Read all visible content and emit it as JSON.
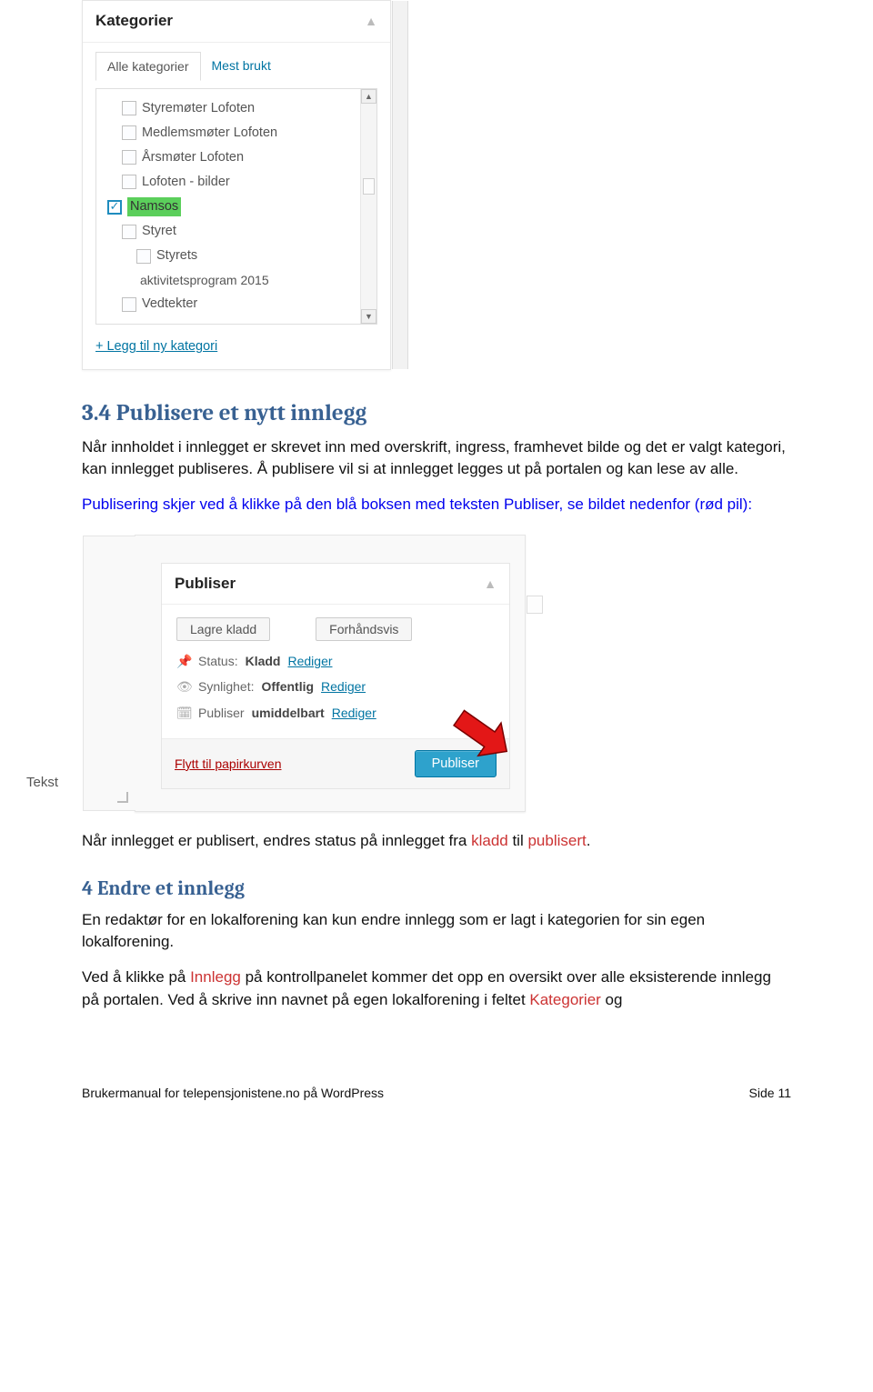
{
  "panel1": {
    "title": "Kategorier",
    "tabs": {
      "all": "Alle kategorier",
      "popular": "Mest brukt"
    },
    "items": [
      {
        "label": "Styremøter Lofoten",
        "checked": false,
        "level": 1
      },
      {
        "label": "Medlemsmøter Lofoten",
        "checked": false,
        "level": 1
      },
      {
        "label": "Årsmøter Lofoten",
        "checked": false,
        "level": 1
      },
      {
        "label": "Lofoten - bilder",
        "checked": false,
        "level": 1
      },
      {
        "label": "Namsos",
        "checked": true,
        "highlight": true,
        "level": 0
      },
      {
        "label": "Styret",
        "checked": false,
        "level": 1
      },
      {
        "label": "Styrets",
        "checked": false,
        "level": 2
      }
    ],
    "extra_line": "aktivitetsprogram 2015",
    "extra_item": "Vedtekter",
    "add": "+ Legg til ny kategori"
  },
  "section34": {
    "heading": "3.4    Publisere et nytt innlegg",
    "p1": "Når innholdet i innlegget er skrevet inn med overskrift, ingress, framhevet bilde og det er valgt kategori, kan innlegget publiseres. Å publisere vil si at innlegget legges ut på portalen og kan lese av alle.",
    "p2a": "Publisering skjer ved å klikke på den blå boksen med teksten ",
    "p2b": "Publiser",
    "p2c": ", se bildet nedenfor (rød pil):"
  },
  "publish": {
    "title": "Publiser",
    "save_draft": "Lagre kladd",
    "preview": "Forhåndsvis",
    "status_label": "Status:",
    "status_value": "Kladd",
    "visibility_label": "Synlighet:",
    "visibility_value": "Offentlig",
    "schedule_label": "Publiser",
    "schedule_value": "umiddelbart",
    "edit": "Rediger",
    "trash": "Flytt til papirkurven",
    "publish_button": "Publiser",
    "tekst_tab": "Tekst"
  },
  "after_publish": {
    "p_a": "Når innlegget er publisert, endres status på innlegget fra ",
    "kladd": "kladd",
    "til": " til ",
    "publisert": "publisert",
    "dot": "."
  },
  "section4": {
    "heading": "4    Endre et innlegg",
    "p1": "En redaktør for en lokalforening kan kun endre innlegg som er lagt i kategorien for sin egen lokalforening.",
    "p2a": "Ved å klikke på ",
    "p2b": "Innlegg",
    "p2c": " på kontrollpanelet kommer det opp en oversikt over alle eksisterende innlegg på portalen. Ved å skrive inn navnet på egen lokalforening i feltet ",
    "p2d": "Kategorier",
    "p2e": " og"
  },
  "footer": {
    "left": "Brukermanual for telepensjonistene.no på WordPress",
    "right": "Side 11"
  }
}
